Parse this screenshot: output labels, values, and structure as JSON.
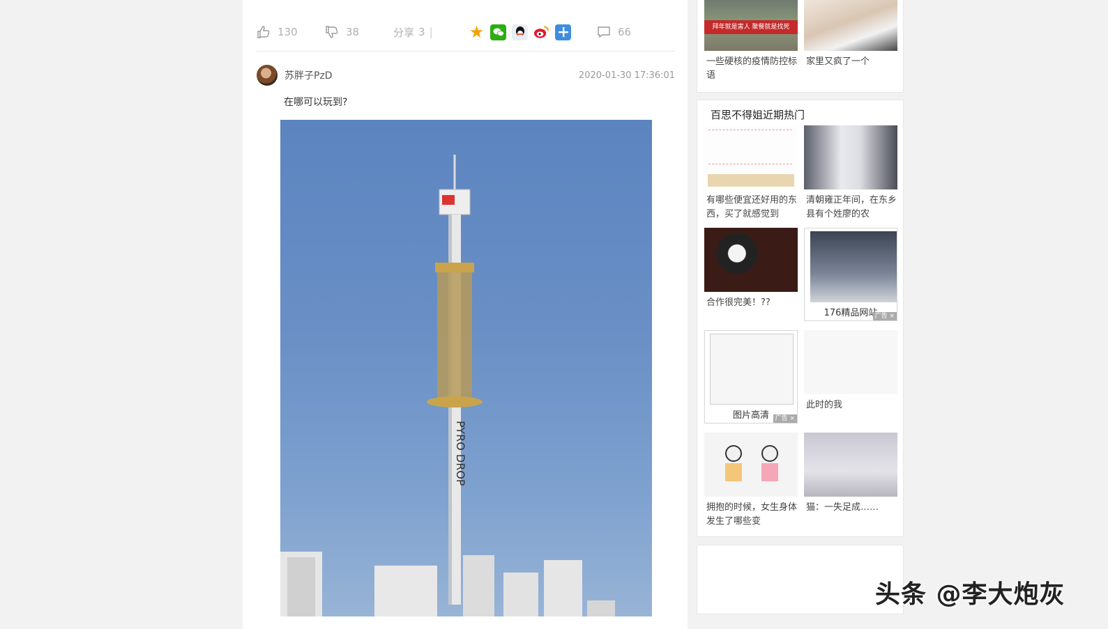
{
  "actions": {
    "like_count": "130",
    "dislike_count": "38",
    "share_label": "分享",
    "share_count": "3",
    "share_separator": "|",
    "comment_count": "66",
    "share_targets": [
      "star-icon",
      "wechat-icon",
      "qq-icon",
      "weibo-icon",
      "more-share-icon"
    ]
  },
  "comment": {
    "username": "苏胖子PzD",
    "timestamp": "2020-01-30 17:36:01",
    "text": "在哪可以玩到?"
  },
  "photo": {
    "tower_text": "PYRO DROP",
    "sign_text": "PYRO DROP"
  },
  "sidebar_top": {
    "items": [
      {
        "caption": "一些硬核的疫情防控标语",
        "banner_text": "拜年就是害人  聚餐就是找死"
      },
      {
        "caption": "家里又疯了一个"
      }
    ]
  },
  "hot": {
    "title": "百思不得姐近期热门",
    "items": [
      {
        "caption": "有哪些便宜还好用的东西，买了就感觉到"
      },
      {
        "caption": "清朝雍正年间，在东乡县有个姓廖的农"
      },
      {
        "caption": "合作很完美！??"
      },
      {
        "caption": "176精品网站",
        "ad_badge": "广告 ×"
      },
      {
        "caption": "图片高清",
        "ad_badge": "广告 ×"
      },
      {
        "caption": "此时的我"
      },
      {
        "caption": "拥抱的时候，女生身体发生了哪些变"
      },
      {
        "caption": "猫：一失足成……"
      }
    ]
  },
  "watermark": "头条 @李大炮灰"
}
